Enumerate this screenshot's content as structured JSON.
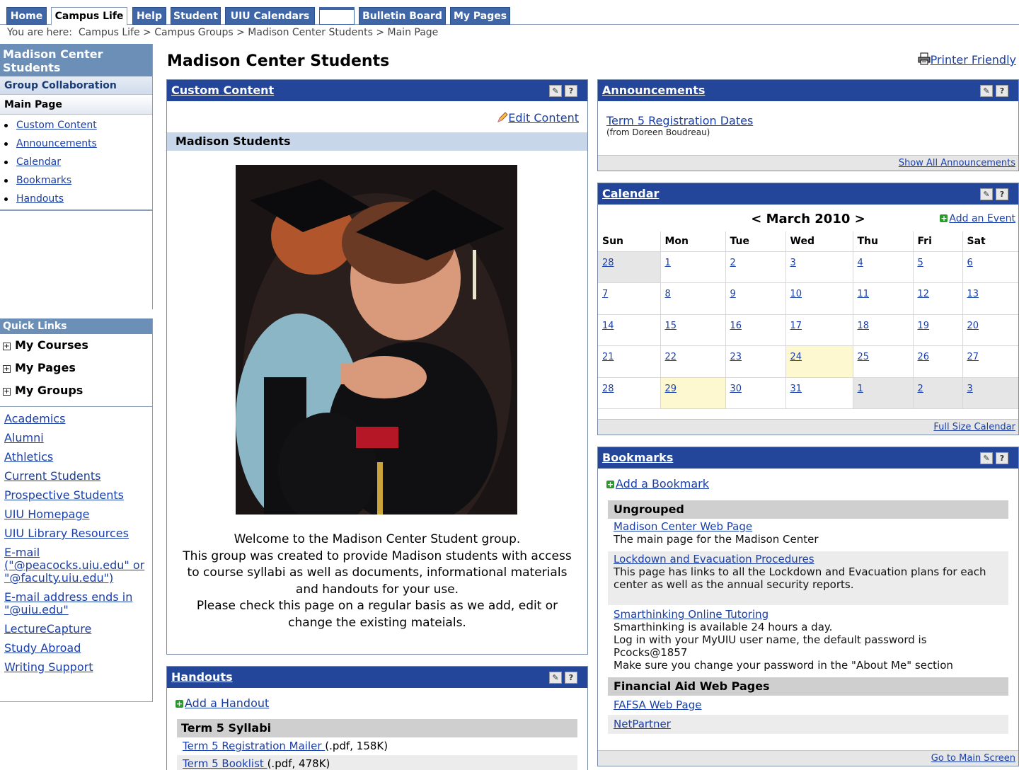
{
  "nav": {
    "tabs": [
      {
        "label": "Home"
      },
      {
        "label": "Campus Life"
      },
      {
        "label": "Help"
      },
      {
        "label": "Student"
      },
      {
        "label": "UIU Calendars"
      },
      {
        "label": ""
      },
      {
        "label": "Bulletin Board"
      },
      {
        "label": "My Pages"
      }
    ],
    "breadcrumb_prefix": "You are here:",
    "breadcrumb": [
      "Campus Life",
      "Campus Groups",
      "Madison Center Students",
      "Main Page"
    ],
    "breadcrumb_sep": ">"
  },
  "left": {
    "group_title": "Madison Center Students",
    "group_collab": "Group Collaboration",
    "main_page": "Main Page",
    "items": [
      "Custom Content",
      "Announcements",
      "Calendar",
      "Bookmarks",
      "Handouts"
    ]
  },
  "quick_links": {
    "title": "Quick Links",
    "trees": [
      "My Courses",
      "My Pages",
      "My Groups"
    ],
    "links": [
      "Academics",
      "Alumni",
      "Athletics",
      "Current Students",
      "Prospective Students",
      "UIU Homepage",
      "UIU Library Resources",
      "E-mail (\"@peacocks.uiu.edu\" or \"@faculty.uiu.edu\")",
      "E-mail address ends in \"@uiu.edu\"",
      "LectureCapture",
      "Study Abroad",
      "Writing Support"
    ]
  },
  "page": {
    "title": "Madison Center Students",
    "printer_friendly": "Printer Friendly"
  },
  "custom_content": {
    "title": "Custom Content",
    "edit": "Edit Content",
    "subhead": "Madison Students",
    "welcome_lines": [
      "Welcome to the Madison Center Student group.",
      "This group was created to provide Madison students with access",
      "to course syllabi as well as documents, informational materials",
      "and handouts for your use.",
      "Please check this page on a regular basis as we add, edit or",
      "change the existing mateials."
    ]
  },
  "handouts": {
    "title": "Handouts",
    "add": "Add a Handout",
    "group": "Term 5 Syllabi",
    "rows": [
      {
        "name": "Term 5 Registration Mailer ",
        "meta": "(.pdf, 158K)"
      },
      {
        "name": "Term 5 Booklist ",
        "meta": "(.pdf, 478K)"
      }
    ]
  },
  "announcements": {
    "title": "Announcements",
    "item_title": "Term 5 Registration Dates",
    "item_from": "(from Doreen Boudreau)",
    "show_all": "Show All Announcements"
  },
  "calendar": {
    "title": "Calendar",
    "month": "< March 2010 >",
    "add_event": "Add an Event",
    "days": [
      "Sun",
      "Mon",
      "Tue",
      "Wed",
      "Thu",
      "Fri",
      "Sat"
    ],
    "weeks": [
      [
        "28",
        "1",
        "2",
        "3",
        "4",
        "5",
        "6"
      ],
      [
        "7",
        "8",
        "9",
        "10",
        "11",
        "12",
        "13"
      ],
      [
        "14",
        "15",
        "16",
        "17",
        "18",
        "19",
        "20"
      ],
      [
        "21",
        "22",
        "23",
        "24",
        "25",
        "26",
        "27"
      ],
      [
        "28",
        "29",
        "30",
        "31",
        "1",
        "2",
        "3"
      ]
    ],
    "full_size": "Full Size Calendar"
  },
  "bookmarks": {
    "title": "Bookmarks",
    "add": "Add a Bookmark",
    "groups": [
      {
        "name": "Ungrouped",
        "items": [
          {
            "title": "Madison Center Web Page",
            "desc": "The main page for the Madison Center"
          },
          {
            "title": "Lockdown and Evacuation Procedures",
            "desc": "This page has links to all the Lockdown and Evacuation plans for each center as well as the annual security reports."
          },
          {
            "title": "Smarthinking Online Tutoring",
            "desc": "Smarthinking is available 24 hours a day.\nLog in with your MyUIU user name, the default password is Pcocks@1857\nMake sure you change your password in the \"About Me\" section"
          }
        ]
      },
      {
        "name": "Financial Aid Web Pages",
        "items": [
          {
            "title": "FAFSA Web Page",
            "desc": ""
          },
          {
            "title": "NetPartner",
            "desc": ""
          }
        ]
      }
    ],
    "go_main": "Go to Main Screen"
  },
  "icons": {
    "settings": "settings-icon",
    "help": "help-icon",
    "printer": "printer-icon",
    "add": "add-icon",
    "edit": "pencil-icon",
    "expand": "expand-icon"
  },
  "colors": {
    "header_blue": "#24469a",
    "tab_blue": "#3f66a6",
    "link": "#1a3fa8",
    "today": "#fdf8d0"
  }
}
